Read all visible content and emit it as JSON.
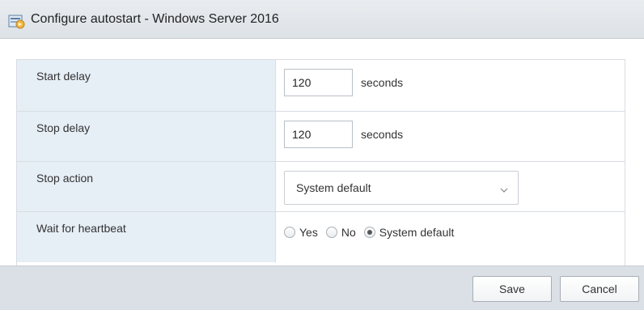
{
  "dialog": {
    "title": "Configure autostart - Windows Server 2016",
    "icon": "vm-autostart-icon"
  },
  "form": {
    "start_delay": {
      "label": "Start delay",
      "value": "120",
      "unit": "seconds"
    },
    "stop_delay": {
      "label": "Stop delay",
      "value": "120",
      "unit": "seconds"
    },
    "stop_action": {
      "label": "Stop action",
      "selected": "System default"
    },
    "wait_for_heartbeat": {
      "label": "Wait for heartbeat",
      "options": [
        "Yes",
        "No",
        "System default"
      ],
      "selected": "System default"
    }
  },
  "buttons": {
    "save": "Save",
    "cancel": "Cancel"
  }
}
